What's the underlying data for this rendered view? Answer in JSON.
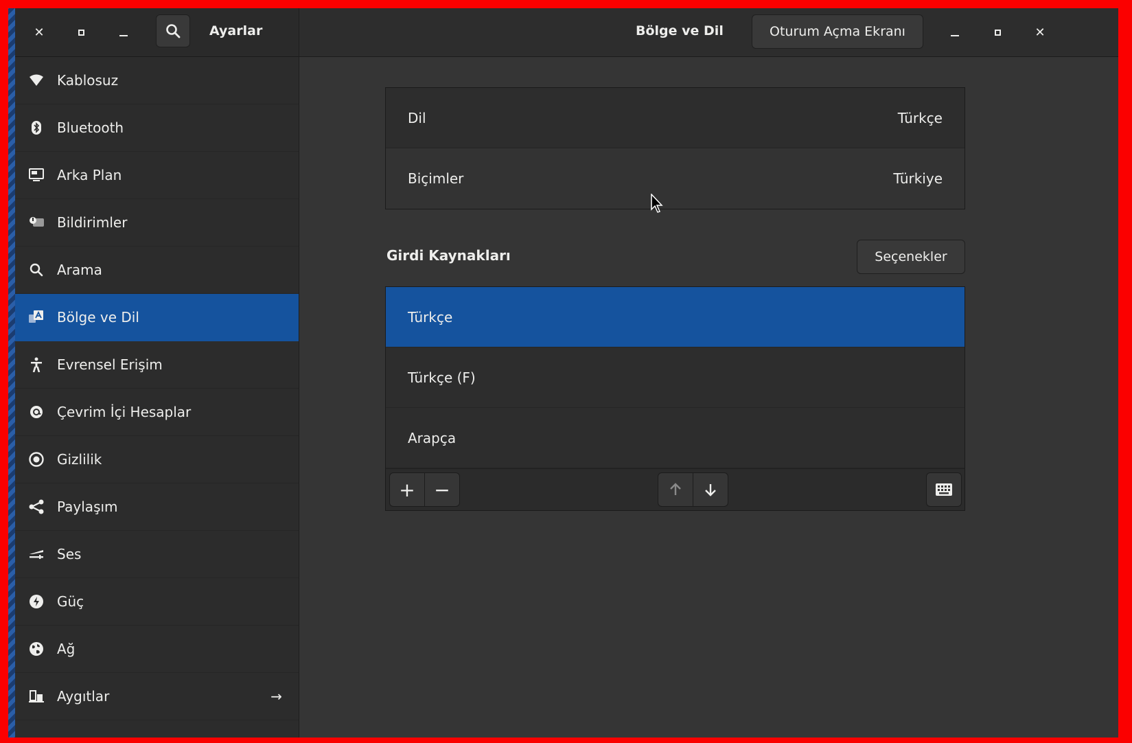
{
  "window": {
    "app_title": "Ayarlar",
    "page_title": "Bölge ve Dil",
    "login_screen_button": "Oturum Açma Ekranı"
  },
  "sidebar": {
    "items": [
      {
        "label": "Kablosuz",
        "icon": "wifi-icon"
      },
      {
        "label": "Bluetooth",
        "icon": "bluetooth-icon"
      },
      {
        "label": "Arka Plan",
        "icon": "display-icon"
      },
      {
        "label": "Bildirimler",
        "icon": "notification-icon"
      },
      {
        "label": "Arama",
        "icon": "search-icon"
      },
      {
        "label": "Bölge ve Dil",
        "icon": "region-language-icon",
        "active": true
      },
      {
        "label": "Evrensel Erişim",
        "icon": "accessibility-icon"
      },
      {
        "label": "Çevrim İçi Hesaplar",
        "icon": "online-accounts-icon"
      },
      {
        "label": "Gizlilik",
        "icon": "privacy-icon"
      },
      {
        "label": "Paylaşım",
        "icon": "share-icon"
      },
      {
        "label": "Ses",
        "icon": "sound-icon"
      },
      {
        "label": "Güç",
        "icon": "power-icon"
      },
      {
        "label": "Ağ",
        "icon": "network-icon"
      },
      {
        "label": "Aygıtlar",
        "icon": "devices-icon",
        "has_arrow": true
      }
    ]
  },
  "language": {
    "rows": [
      {
        "label": "Dil",
        "value": "Türkçe"
      },
      {
        "label": "Biçimler",
        "value": "Türkiye"
      }
    ]
  },
  "input_sources": {
    "title": "Girdi Kaynakları",
    "options_button": "Seçenekler",
    "items": [
      "Türkçe",
      "Türkçe (F)",
      "Arapça"
    ],
    "selected": "Türkçe"
  },
  "colors": {
    "accent": "#15539e",
    "frame": "#fb0000",
    "window_bg": "#353535"
  }
}
